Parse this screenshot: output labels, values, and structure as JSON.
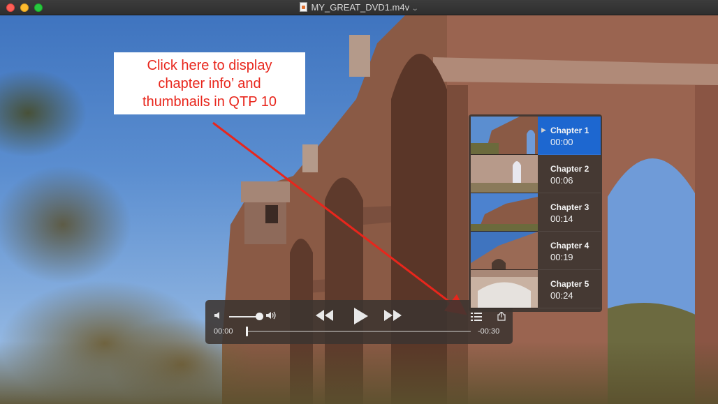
{
  "window": {
    "title": "MY_GREAT_DVD1.m4v"
  },
  "annotation": {
    "lines": [
      "Click here to display",
      "chapter info’  and",
      "thumbnails in QTP 10"
    ],
    "color": "#e8261c"
  },
  "player": {
    "current_time": "00:00",
    "remaining_time": "-00:30",
    "volume_fraction": 0.85,
    "progress_fraction": 0.0
  },
  "chapters": [
    {
      "name": "Chapter 1",
      "time": "00:00",
      "selected": true
    },
    {
      "name": "Chapter 2",
      "time": "00:06",
      "selected": false
    },
    {
      "name": "Chapter 3",
      "time": "00:14",
      "selected": false
    },
    {
      "name": "Chapter 4",
      "time": "00:19",
      "selected": false
    },
    {
      "name": "Chapter 5",
      "time": "00:24",
      "selected": false
    }
  ],
  "colors": {
    "selection": "#1d67d0",
    "close": "#fe5f57",
    "minimize": "#febc2e",
    "maximize": "#28c840"
  },
  "icons": {
    "close": "close-icon",
    "minimize": "minimize-icon",
    "maximize": "maximize-icon",
    "volume_low": "volume-low-icon",
    "volume_high": "volume-high-icon",
    "rewind": "rewind-icon",
    "play": "play-icon",
    "fast_forward": "fast-forward-icon",
    "chapters": "chapter-list-icon",
    "share": "share-icon"
  }
}
